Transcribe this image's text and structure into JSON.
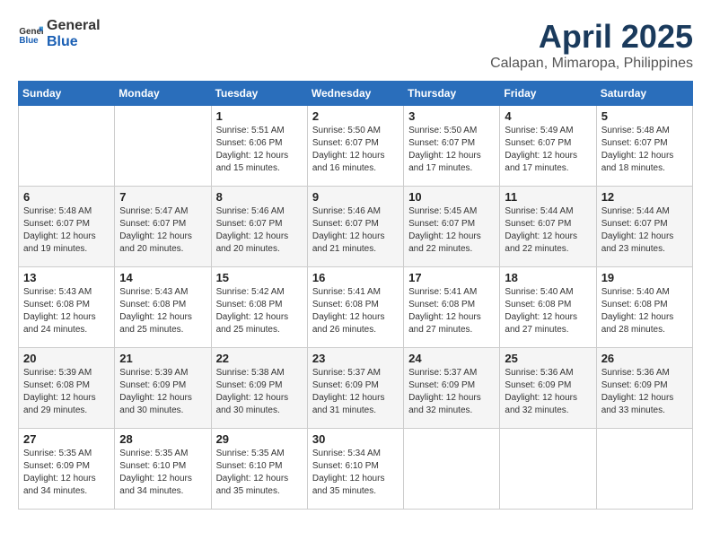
{
  "header": {
    "logo": {
      "general": "General",
      "blue": "Blue"
    },
    "month": "April 2025",
    "location": "Calapan, Mimaropa, Philippines"
  },
  "weekdays": [
    "Sunday",
    "Monday",
    "Tuesday",
    "Wednesday",
    "Thursday",
    "Friday",
    "Saturday"
  ],
  "weeks": [
    [
      null,
      null,
      {
        "day": "1",
        "sunrise": "Sunrise: 5:51 AM",
        "sunset": "Sunset: 6:06 PM",
        "daylight": "Daylight: 12 hours and 15 minutes."
      },
      {
        "day": "2",
        "sunrise": "Sunrise: 5:50 AM",
        "sunset": "Sunset: 6:07 PM",
        "daylight": "Daylight: 12 hours and 16 minutes."
      },
      {
        "day": "3",
        "sunrise": "Sunrise: 5:50 AM",
        "sunset": "Sunset: 6:07 PM",
        "daylight": "Daylight: 12 hours and 17 minutes."
      },
      {
        "day": "4",
        "sunrise": "Sunrise: 5:49 AM",
        "sunset": "Sunset: 6:07 PM",
        "daylight": "Daylight: 12 hours and 17 minutes."
      },
      {
        "day": "5",
        "sunrise": "Sunrise: 5:48 AM",
        "sunset": "Sunset: 6:07 PM",
        "daylight": "Daylight: 12 hours and 18 minutes."
      }
    ],
    [
      {
        "day": "6",
        "sunrise": "Sunrise: 5:48 AM",
        "sunset": "Sunset: 6:07 PM",
        "daylight": "Daylight: 12 hours and 19 minutes."
      },
      {
        "day": "7",
        "sunrise": "Sunrise: 5:47 AM",
        "sunset": "Sunset: 6:07 PM",
        "daylight": "Daylight: 12 hours and 20 minutes."
      },
      {
        "day": "8",
        "sunrise": "Sunrise: 5:46 AM",
        "sunset": "Sunset: 6:07 PM",
        "daylight": "Daylight: 12 hours and 20 minutes."
      },
      {
        "day": "9",
        "sunrise": "Sunrise: 5:46 AM",
        "sunset": "Sunset: 6:07 PM",
        "daylight": "Daylight: 12 hours and 21 minutes."
      },
      {
        "day": "10",
        "sunrise": "Sunrise: 5:45 AM",
        "sunset": "Sunset: 6:07 PM",
        "daylight": "Daylight: 12 hours and 22 minutes."
      },
      {
        "day": "11",
        "sunrise": "Sunrise: 5:44 AM",
        "sunset": "Sunset: 6:07 PM",
        "daylight": "Daylight: 12 hours and 22 minutes."
      },
      {
        "day": "12",
        "sunrise": "Sunrise: 5:44 AM",
        "sunset": "Sunset: 6:07 PM",
        "daylight": "Daylight: 12 hours and 23 minutes."
      }
    ],
    [
      {
        "day": "13",
        "sunrise": "Sunrise: 5:43 AM",
        "sunset": "Sunset: 6:08 PM",
        "daylight": "Daylight: 12 hours and 24 minutes."
      },
      {
        "day": "14",
        "sunrise": "Sunrise: 5:43 AM",
        "sunset": "Sunset: 6:08 PM",
        "daylight": "Daylight: 12 hours and 25 minutes."
      },
      {
        "day": "15",
        "sunrise": "Sunrise: 5:42 AM",
        "sunset": "Sunset: 6:08 PM",
        "daylight": "Daylight: 12 hours and 25 minutes."
      },
      {
        "day": "16",
        "sunrise": "Sunrise: 5:41 AM",
        "sunset": "Sunset: 6:08 PM",
        "daylight": "Daylight: 12 hours and 26 minutes."
      },
      {
        "day": "17",
        "sunrise": "Sunrise: 5:41 AM",
        "sunset": "Sunset: 6:08 PM",
        "daylight": "Daylight: 12 hours and 27 minutes."
      },
      {
        "day": "18",
        "sunrise": "Sunrise: 5:40 AM",
        "sunset": "Sunset: 6:08 PM",
        "daylight": "Daylight: 12 hours and 27 minutes."
      },
      {
        "day": "19",
        "sunrise": "Sunrise: 5:40 AM",
        "sunset": "Sunset: 6:08 PM",
        "daylight": "Daylight: 12 hours and 28 minutes."
      }
    ],
    [
      {
        "day": "20",
        "sunrise": "Sunrise: 5:39 AM",
        "sunset": "Sunset: 6:08 PM",
        "daylight": "Daylight: 12 hours and 29 minutes."
      },
      {
        "day": "21",
        "sunrise": "Sunrise: 5:39 AM",
        "sunset": "Sunset: 6:09 PM",
        "daylight": "Daylight: 12 hours and 30 minutes."
      },
      {
        "day": "22",
        "sunrise": "Sunrise: 5:38 AM",
        "sunset": "Sunset: 6:09 PM",
        "daylight": "Daylight: 12 hours and 30 minutes."
      },
      {
        "day": "23",
        "sunrise": "Sunrise: 5:37 AM",
        "sunset": "Sunset: 6:09 PM",
        "daylight": "Daylight: 12 hours and 31 minutes."
      },
      {
        "day": "24",
        "sunrise": "Sunrise: 5:37 AM",
        "sunset": "Sunset: 6:09 PM",
        "daylight": "Daylight: 12 hours and 32 minutes."
      },
      {
        "day": "25",
        "sunrise": "Sunrise: 5:36 AM",
        "sunset": "Sunset: 6:09 PM",
        "daylight": "Daylight: 12 hours and 32 minutes."
      },
      {
        "day": "26",
        "sunrise": "Sunrise: 5:36 AM",
        "sunset": "Sunset: 6:09 PM",
        "daylight": "Daylight: 12 hours and 33 minutes."
      }
    ],
    [
      {
        "day": "27",
        "sunrise": "Sunrise: 5:35 AM",
        "sunset": "Sunset: 6:09 PM",
        "daylight": "Daylight: 12 hours and 34 minutes."
      },
      {
        "day": "28",
        "sunrise": "Sunrise: 5:35 AM",
        "sunset": "Sunset: 6:10 PM",
        "daylight": "Daylight: 12 hours and 34 minutes."
      },
      {
        "day": "29",
        "sunrise": "Sunrise: 5:35 AM",
        "sunset": "Sunset: 6:10 PM",
        "daylight": "Daylight: 12 hours and 35 minutes."
      },
      {
        "day": "30",
        "sunrise": "Sunrise: 5:34 AM",
        "sunset": "Sunset: 6:10 PM",
        "daylight": "Daylight: 12 hours and 35 minutes."
      },
      null,
      null,
      null
    ]
  ]
}
